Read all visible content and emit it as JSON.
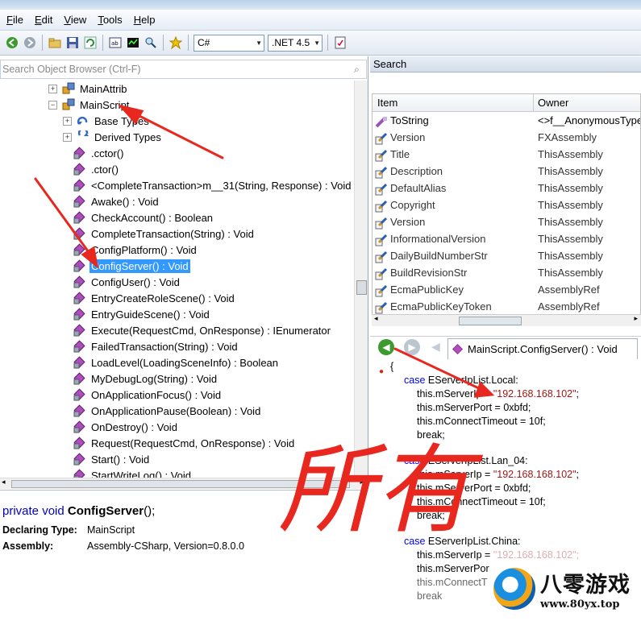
{
  "menu": [
    "File",
    "Edit",
    "View",
    "Tools",
    "Help"
  ],
  "toolbar": {
    "language": "C#",
    "framework": ".NET 4.5"
  },
  "object_browser": {
    "search_placeholder": "Search Object Browser (Ctrl-F)",
    "tree": [
      {
        "label": "MainAttrib",
        "icon": "class-icon",
        "expander": "+"
      },
      {
        "label": "MainScript",
        "icon": "class-icon",
        "expander": "-"
      },
      {
        "label": "Base Types",
        "icon": "base-types-icon",
        "expander": "+"
      },
      {
        "label": "Derived Types",
        "icon": "derived-types-icon",
        "expander": "+"
      },
      {
        "label": ".cctor()",
        "icon": "method-icon"
      },
      {
        "label": ".ctor()",
        "icon": "method-icon"
      },
      {
        "label": "<CompleteTransaction>m__31(String, Response) : Void",
        "icon": "method-icon"
      },
      {
        "label": "Awake() : Void",
        "icon": "method-icon"
      },
      {
        "label": "CheckAccount() : Boolean",
        "icon": "method-icon"
      },
      {
        "label": "CompleteTransaction(String) : Void",
        "icon": "method-icon"
      },
      {
        "label": "ConfigPlatform() : Void",
        "icon": "method-icon"
      },
      {
        "label": "ConfigServer() : Void",
        "icon": "method-icon",
        "selected": true
      },
      {
        "label": "ConfigUser() : Void",
        "icon": "method-icon"
      },
      {
        "label": "EntryCreateRoleScene() : Void",
        "icon": "method-icon"
      },
      {
        "label": "EntryGuideScene() : Void",
        "icon": "method-icon"
      },
      {
        "label": "Execute(RequestCmd, OnResponse) : IEnumerator",
        "icon": "method-icon"
      },
      {
        "label": "FailedTransaction(String) : Void",
        "icon": "method-icon"
      },
      {
        "label": "LoadLevel(LoadingSceneInfo) : Boolean",
        "icon": "method-icon"
      },
      {
        "label": "MyDebugLog(String) : Void",
        "icon": "method-icon"
      },
      {
        "label": "OnApplicationFocus() : Void",
        "icon": "method-icon"
      },
      {
        "label": "OnApplicationPause(Boolean) : Void",
        "icon": "method-icon"
      },
      {
        "label": "OnDestroy() : Void",
        "icon": "method-icon"
      },
      {
        "label": "Request(RequestCmd, OnResponse) : Void",
        "icon": "method-icon"
      },
      {
        "label": "Start() : Void",
        "icon": "method-icon"
      },
      {
        "label": "StartWriteLog() : Void",
        "icon": "method-icon"
      }
    ]
  },
  "detail": {
    "sig_modifiers": "private void",
    "sig_name": "ConfigServer",
    "sig_tail": "();",
    "declaring_label": "Declaring Type:",
    "declaring_value": "MainScript",
    "assembly_label": "Assembly:",
    "assembly_value": "Assembly-CSharp, Version=0.8.0.0"
  },
  "search_panel": {
    "title": "Search",
    "col_item": "Item",
    "col_owner": "Owner",
    "rows": [
      {
        "item": "ToString",
        "owner": "<>f__AnonymousType"
      },
      {
        "item": "Version",
        "owner": "FXAssembly"
      },
      {
        "item": "Title",
        "owner": "ThisAssembly"
      },
      {
        "item": "Description",
        "owner": "ThisAssembly"
      },
      {
        "item": "DefaultAlias",
        "owner": "ThisAssembly"
      },
      {
        "item": "Copyright",
        "owner": "ThisAssembly"
      },
      {
        "item": "Version",
        "owner": "ThisAssembly"
      },
      {
        "item": "InformationalVersion",
        "owner": "ThisAssembly"
      },
      {
        "item": "DailyBuildNumberStr",
        "owner": "ThisAssembly"
      },
      {
        "item": "BuildRevisionStr",
        "owner": "ThisAssembly"
      },
      {
        "item": "EcmaPublicKey",
        "owner": "AssemblyRef"
      },
      {
        "item": "EcmaPublicKeyToken",
        "owner": "AssemblyRef"
      }
    ]
  },
  "code_tab": "MainScript.ConfigServer() : Void",
  "code": {
    "open_brace": "{",
    "case1": "EServerIpList.Local:",
    "case2": "EServerIpList.Lan_04:",
    "case3": "EServerIpList.China:",
    "ip_field": "this.mServerIp = ",
    "ip_value": "\"192.168.168.102\"",
    "ip_semicolon": ";",
    "ip3_partial": "this.mServerIp = ",
    "ip3_value_partial": "\"192.168.168.102\";",
    "port": "this.mServerPort = 0xbfd;",
    "port3_partial": "this.mServerPor",
    "timeout": "this.mConnectTimeout = 10f;",
    "timeout3_partial": "this.mConnectT",
    "brk": "break;",
    "brk3_partial": "break",
    "kw_case": "case"
  },
  "annotation": {
    "handwriting": "所有",
    "color": "#e8271f"
  },
  "watermark": {
    "cn": "八零游戏",
    "url": "www.80yx.top"
  }
}
